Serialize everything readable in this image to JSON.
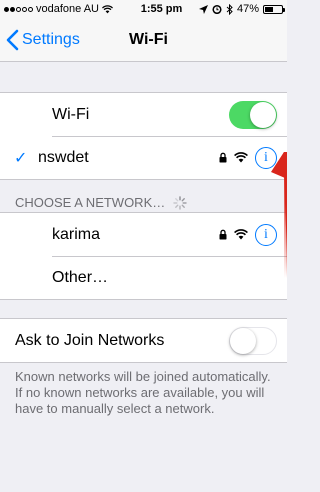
{
  "status_bar": {
    "carrier": "vodafone AU",
    "time": "1:55 pm",
    "battery": "47%",
    "battery_level": 0.47,
    "signal_bars": 2,
    "icons": [
      "signal-icon",
      "wifi-icon",
      "location-icon",
      "alarm-icon",
      "bluetooth-icon",
      "battery-icon"
    ]
  },
  "nav": {
    "back_label": "Settings",
    "title": "Wi-Fi"
  },
  "wifi_toggle": {
    "label": "Wi-Fi",
    "on": true
  },
  "connected": {
    "name": "nswdet",
    "checkmark": "✓",
    "info": "i"
  },
  "choose_section": {
    "header": "CHOOSE A NETWORK…"
  },
  "networks": [
    {
      "name": "karima",
      "secured": true,
      "info": "i"
    }
  ],
  "other_label": "Other…",
  "ask_join": {
    "label": "Ask to Join Networks",
    "on": false
  },
  "footer": "Known networks will be joined automatically. If no known networks are available, you will have to manually select a network.",
  "colors": {
    "accent": "#007aff",
    "toggle_on": "#4cd964",
    "annotation_arrow": "#d9261c"
  }
}
